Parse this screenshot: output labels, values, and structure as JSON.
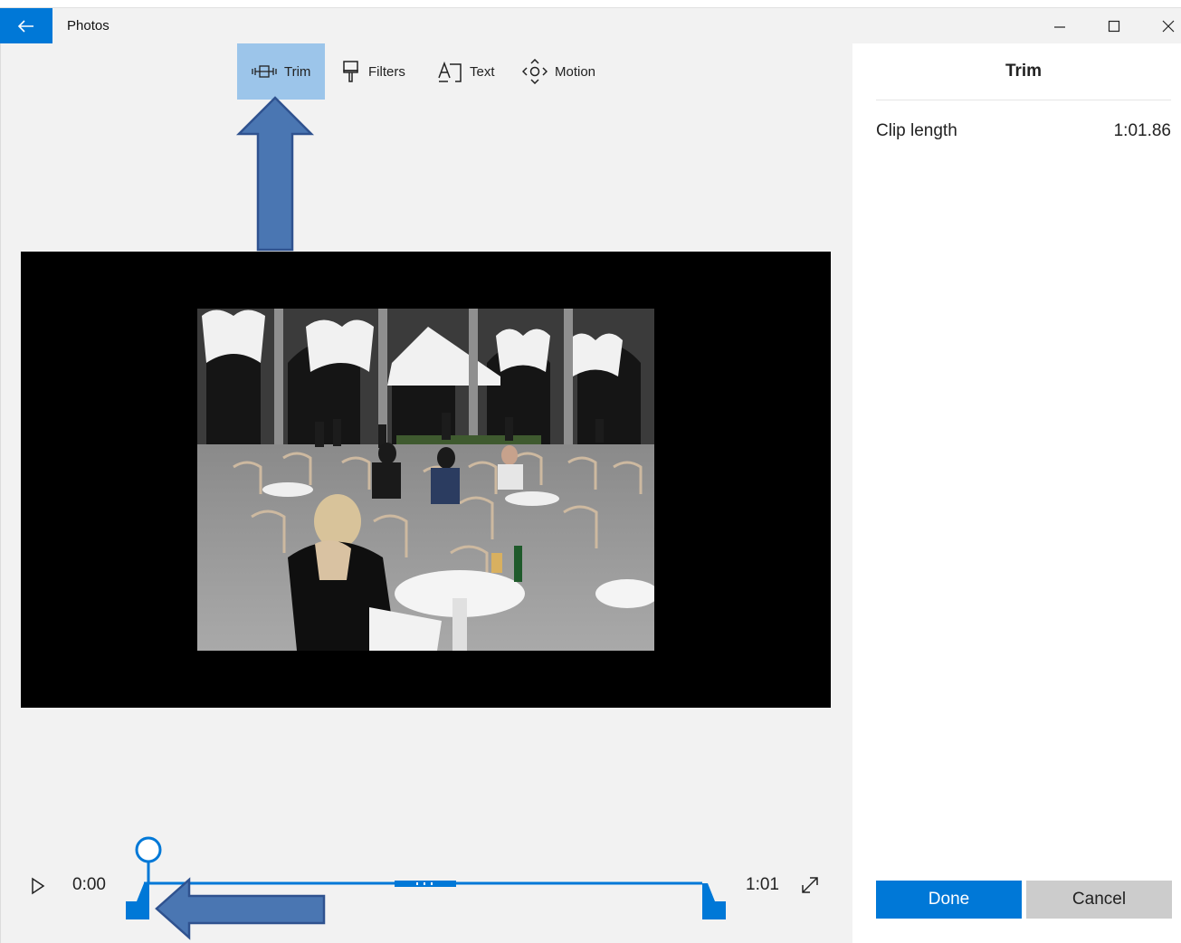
{
  "window": {
    "title": "Photos",
    "back_icon": "arrow-left-icon",
    "minimize_icon": "minimize-icon",
    "maximize_icon": "maximize-icon",
    "close_icon": "close-icon"
  },
  "toolbar": {
    "tools": [
      {
        "label": "Trim",
        "icon": "trim-icon",
        "active": true
      },
      {
        "label": "Filters",
        "icon": "filters-brush-icon",
        "active": false
      },
      {
        "label": "Text",
        "icon": "text-icon",
        "active": false
      },
      {
        "label": "Motion",
        "icon": "motion-icon",
        "active": false
      }
    ]
  },
  "playback": {
    "play_icon": "play-icon",
    "current_time": "0:00",
    "end_time": "1:01",
    "expand_icon": "expand-icon",
    "progress": 0.0
  },
  "pane": {
    "title": "Trim",
    "clip_length_label": "Clip length",
    "clip_length_value": "1:01.86",
    "done_label": "Done",
    "cancel_label": "Cancel"
  },
  "colors": {
    "accent": "#0078d7",
    "active_tool": "#9cc5ea",
    "annotation_arrow": "#4a76b2"
  }
}
